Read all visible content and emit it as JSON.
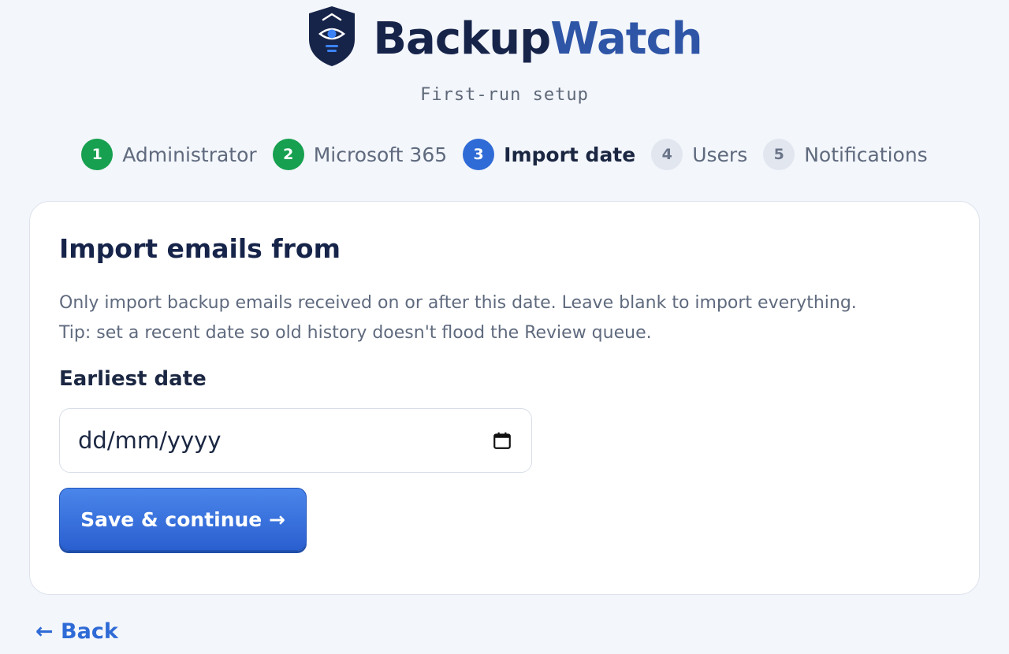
{
  "brand": {
    "name_part1": "Backup",
    "name_part2": "Watch",
    "logo_icon": "shield-eye-icon",
    "colors": {
      "dark": "#17244a",
      "accent": "#2e55a6"
    }
  },
  "subtitle": "First-run setup",
  "steps": [
    {
      "number": "1",
      "label": "Administrator",
      "state": "done"
    },
    {
      "number": "2",
      "label": "Microsoft 365",
      "state": "done"
    },
    {
      "number": "3",
      "label": "Import date",
      "state": "active"
    },
    {
      "number": "4",
      "label": "Users",
      "state": "todo"
    },
    {
      "number": "5",
      "label": "Notifications",
      "state": "todo"
    }
  ],
  "step_colors": {
    "done": "#16a04f",
    "active": "#2f6bd6",
    "todo": "#e1e6ef"
  },
  "card": {
    "title": "Import emails from",
    "description_line1": "Only import backup emails received on or after this date. Leave blank to import everything.",
    "description_line2": "Tip: set a recent date so old history doesn't flood the Review queue.",
    "field_label": "Earliest date",
    "date_placeholder": "dd/mm/yyyy",
    "date_icon": "calendar-icon",
    "save_label": "Save & continue →"
  },
  "back_label": "← Back"
}
